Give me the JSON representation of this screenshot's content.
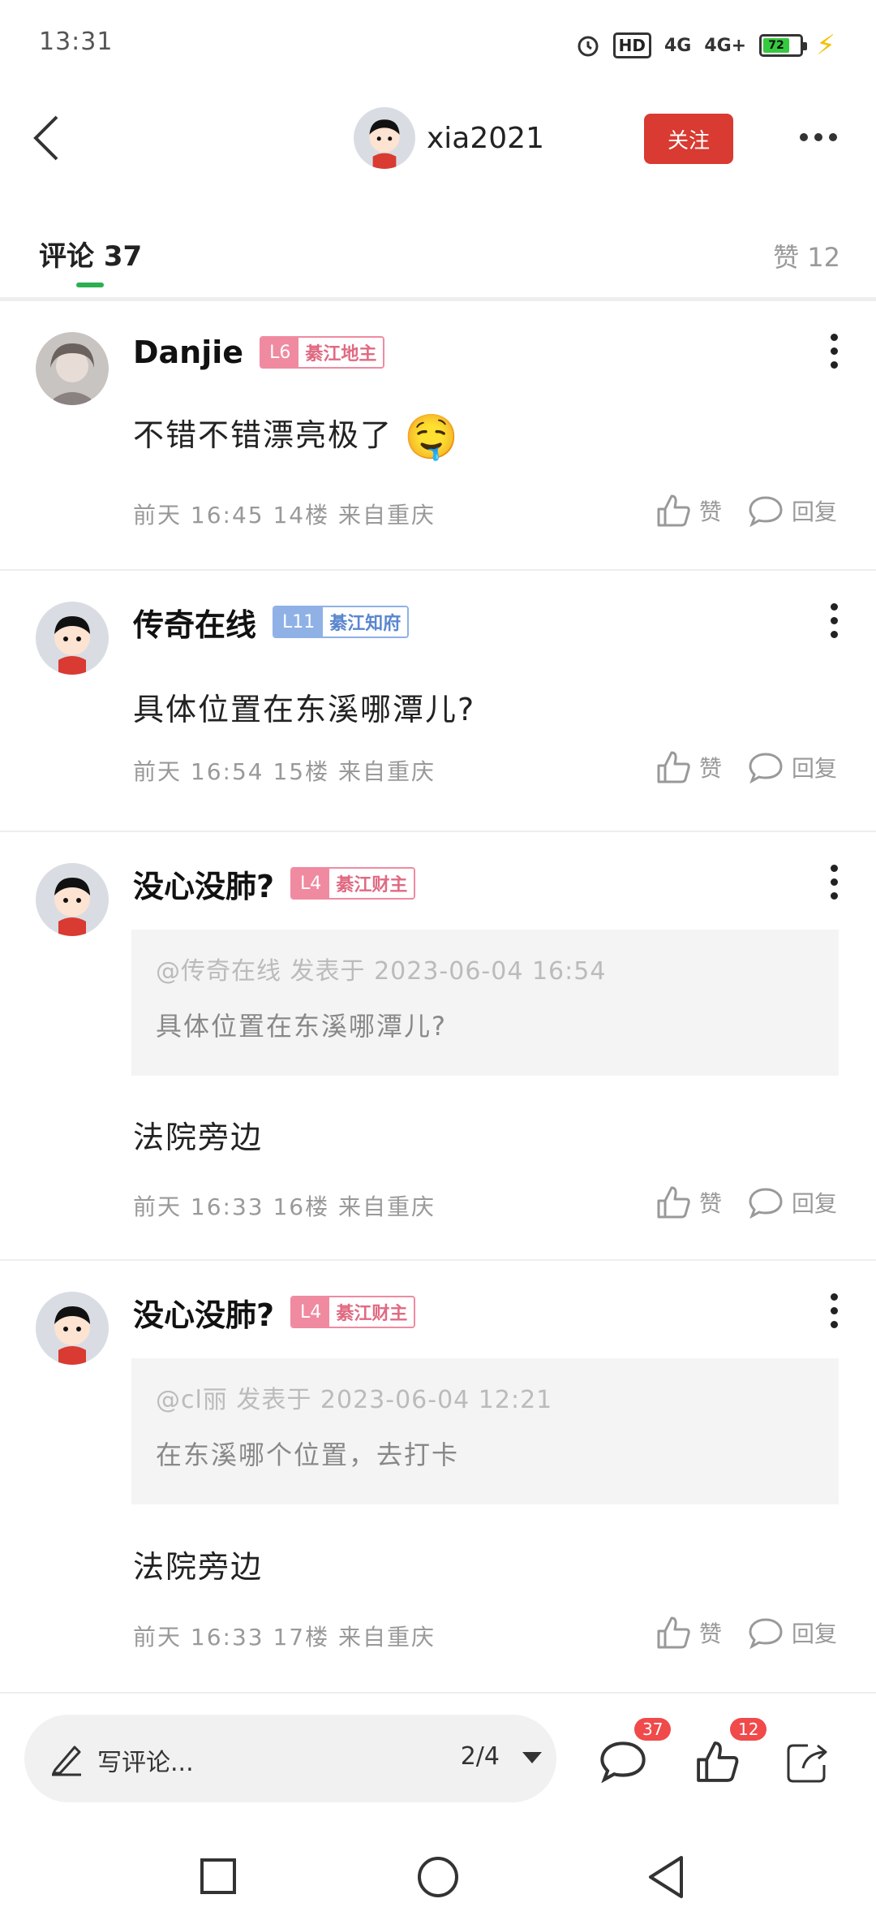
{
  "status": {
    "time": "13:31",
    "network1": "4G",
    "network2": "4G+",
    "hd": "HD",
    "battery": "72"
  },
  "header": {
    "username": "xia2021",
    "follow_label": "关注"
  },
  "tabs": {
    "comments_label": "评论",
    "comments_count": "37",
    "likes_label": "赞",
    "likes_count": "12"
  },
  "actions": {
    "like_label": "赞",
    "reply_label": "回复"
  },
  "comments": [
    {
      "name": "Danjie",
      "level": "L6",
      "title": "綦江地主",
      "badge_color": "pink",
      "text": "不错不错漂亮极了",
      "emoji": "🤤",
      "meta": "前天 16:45 14楼 来自重庆"
    },
    {
      "name": "传奇在线",
      "level": "L11",
      "title": "綦江知府",
      "badge_color": "blue",
      "text": "具体位置在东溪哪潭儿?",
      "meta": "前天 16:54 15楼 来自重庆"
    },
    {
      "name": "没心没肺?",
      "level": "L4",
      "title": "綦江财主",
      "badge_color": "pink",
      "quote_meta": "@传奇在线 发表于 2023-06-04 16:54",
      "quote_text": "具体位置在东溪哪潭儿?",
      "text": "法院旁边",
      "meta": "前天 16:33 16楼 来自重庆"
    },
    {
      "name": "没心没肺?",
      "level": "L4",
      "title": "綦江财主",
      "badge_color": "pink",
      "quote_meta": "@cl丽 发表于 2023-06-04 12:21",
      "quote_text": "在东溪哪个位置，去打卡",
      "text": "法院旁边",
      "meta": "前天 16:33 17楼 来自重庆"
    }
  ],
  "bottom": {
    "write_placeholder": "写评论...",
    "page_indicator": "2/4",
    "comment_badge": "37",
    "like_badge": "12"
  },
  "icons": {
    "back": "chevron-left-icon",
    "more": "more-horizontal-icon",
    "like": "thumbs-up-icon",
    "reply": "speech-bubble-icon",
    "share": "share-icon",
    "write": "pencil-icon"
  },
  "colors": {
    "accent": "#d93a31",
    "tab_indicator": "#2bb04f",
    "badge_red": "#f04a4a"
  }
}
